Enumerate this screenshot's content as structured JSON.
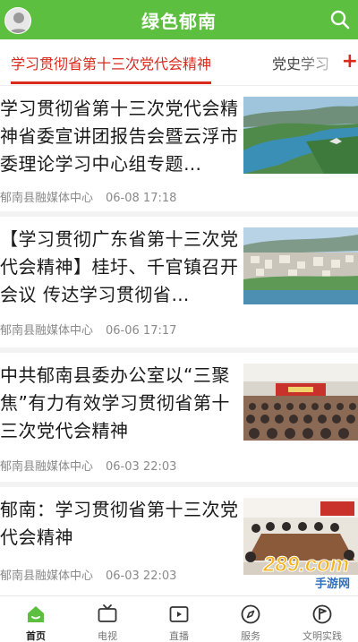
{
  "header": {
    "title": "绿色郁南",
    "brand_color": "#5cbf3f"
  },
  "tabs": {
    "active": "学习贯彻省第十三次党代会精神",
    "other": "党史学习",
    "add_symbol": "+",
    "accent_color": "#d92a1c"
  },
  "articles": [
    {
      "headline": "学习贯彻省第十三次党代会精神省委宣讲团报告会暨云浮市委理论学习中心组专题…",
      "source": "郁南县融媒体中心",
      "time": "06-08 17:18",
      "thumb": "river-aerial-photo"
    },
    {
      "headline": "【学习贯彻广东省第十三次党代会精神】桂圩、千官镇召开会议 传达学习贯彻省…",
      "source": "郁南县融媒体中心",
      "time": "06-06 17:17",
      "thumb": "town-aerial-photo"
    },
    {
      "headline": "中共郁南县委办公室以“三聚焦”有力有效学习贯彻省第十三次党代会精神",
      "source": "郁南县融媒体中心",
      "time": "06-03 22:03",
      "thumb": "conference-hall-photo"
    },
    {
      "headline": "郁南：学习贯彻省第十三次党代会精神",
      "source": "郁南县融媒体中心",
      "time": "06-03 22:03",
      "thumb": "meeting-room-photo"
    }
  ],
  "nav": [
    {
      "label": "首页",
      "icon": "home-icon",
      "active": true
    },
    {
      "label": "电视",
      "icon": "tv-icon",
      "active": false
    },
    {
      "label": "直播",
      "icon": "live-video-icon",
      "active": false
    },
    {
      "label": "服务",
      "icon": "compass-icon",
      "active": false
    },
    {
      "label": "文明实践",
      "icon": "flag-circle-icon",
      "active": false
    }
  ],
  "watermark": {
    "text": "289.com",
    "subtext": "手游网"
  }
}
